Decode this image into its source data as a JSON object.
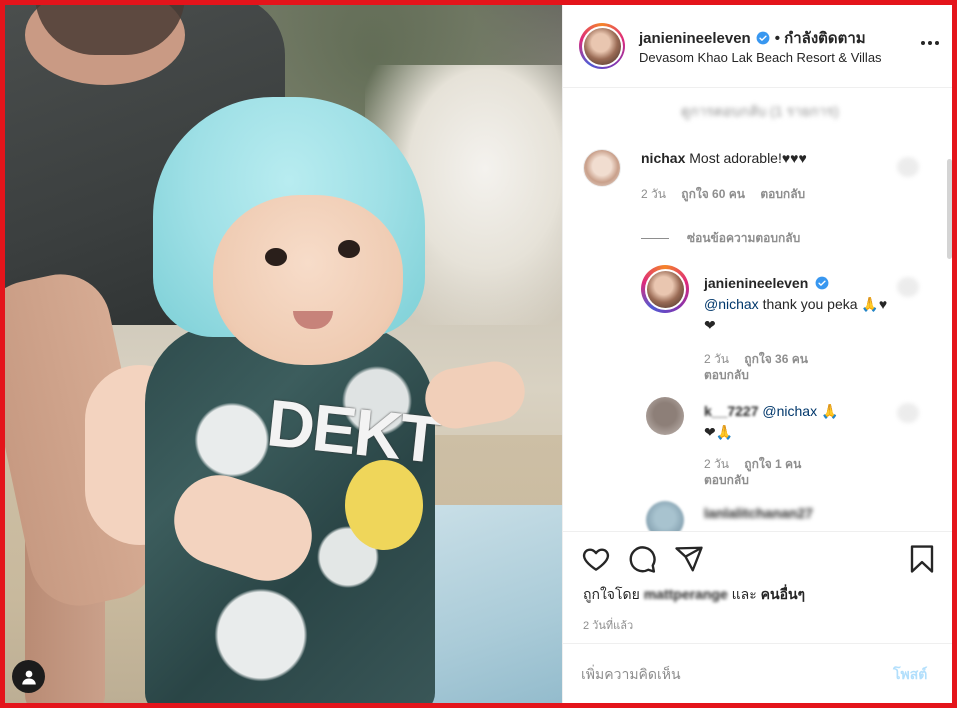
{
  "post": {
    "author": "janienineeleven",
    "follow_status": "• กำลังติดตาม",
    "location": "Devasom Khao Lak Beach Resort & Villas",
    "photo_shirt_text": "DEKT"
  },
  "comments": {
    "blurred_top": "ดูการตอบกลับ (1 รายการ)",
    "items": [
      {
        "user": "nichax",
        "text": "Most adorable!♥♥♥",
        "time": "2 วัน",
        "likes": "ถูกใจ 60 คน",
        "reply": "ตอบกลับ"
      }
    ],
    "hide_replies": "ซ่อนข้อความตอบกลับ",
    "replies": [
      {
        "user": "janienineeleven",
        "mention": "@nichax",
        "text": " thank you peka 🙏♥❤",
        "time": "2 วัน",
        "likes": "ถูกใจ 36 คน",
        "reply": "ตอบกลับ"
      },
      {
        "user": "k__7227",
        "mention": "@nichax",
        "text": " 🙏",
        "text2": "❤🙏",
        "time": "2 วัน",
        "likes": "ถูกใจ 1 คน",
        "reply": "ตอบกลับ"
      },
      {
        "user": "lanlalitchanan27"
      }
    ]
  },
  "actions": {
    "liked_by_prefix": "ถูกใจโดย",
    "liked_by_user": "mattperange",
    "liked_by_and": "และ",
    "liked_by_others": "คนอื่นๆ",
    "time_ago": "2 วันที่แล้ว"
  },
  "add_comment": {
    "placeholder": "เพิ่มความคิดเห็น",
    "post_label": "โพสต์"
  },
  "icons": {
    "like": "heart-icon",
    "comment": "comment-icon",
    "share": "share-icon",
    "save": "bookmark-icon",
    "more": "more-icon",
    "verified": "verified-badge-icon",
    "user_tag": "user-tag-icon"
  },
  "colors": {
    "frame": "#e4141b",
    "verified": "#3897f0",
    "mention": "#00376b",
    "post_disabled": "#b2dffc",
    "muted": "#8e8e8e"
  }
}
